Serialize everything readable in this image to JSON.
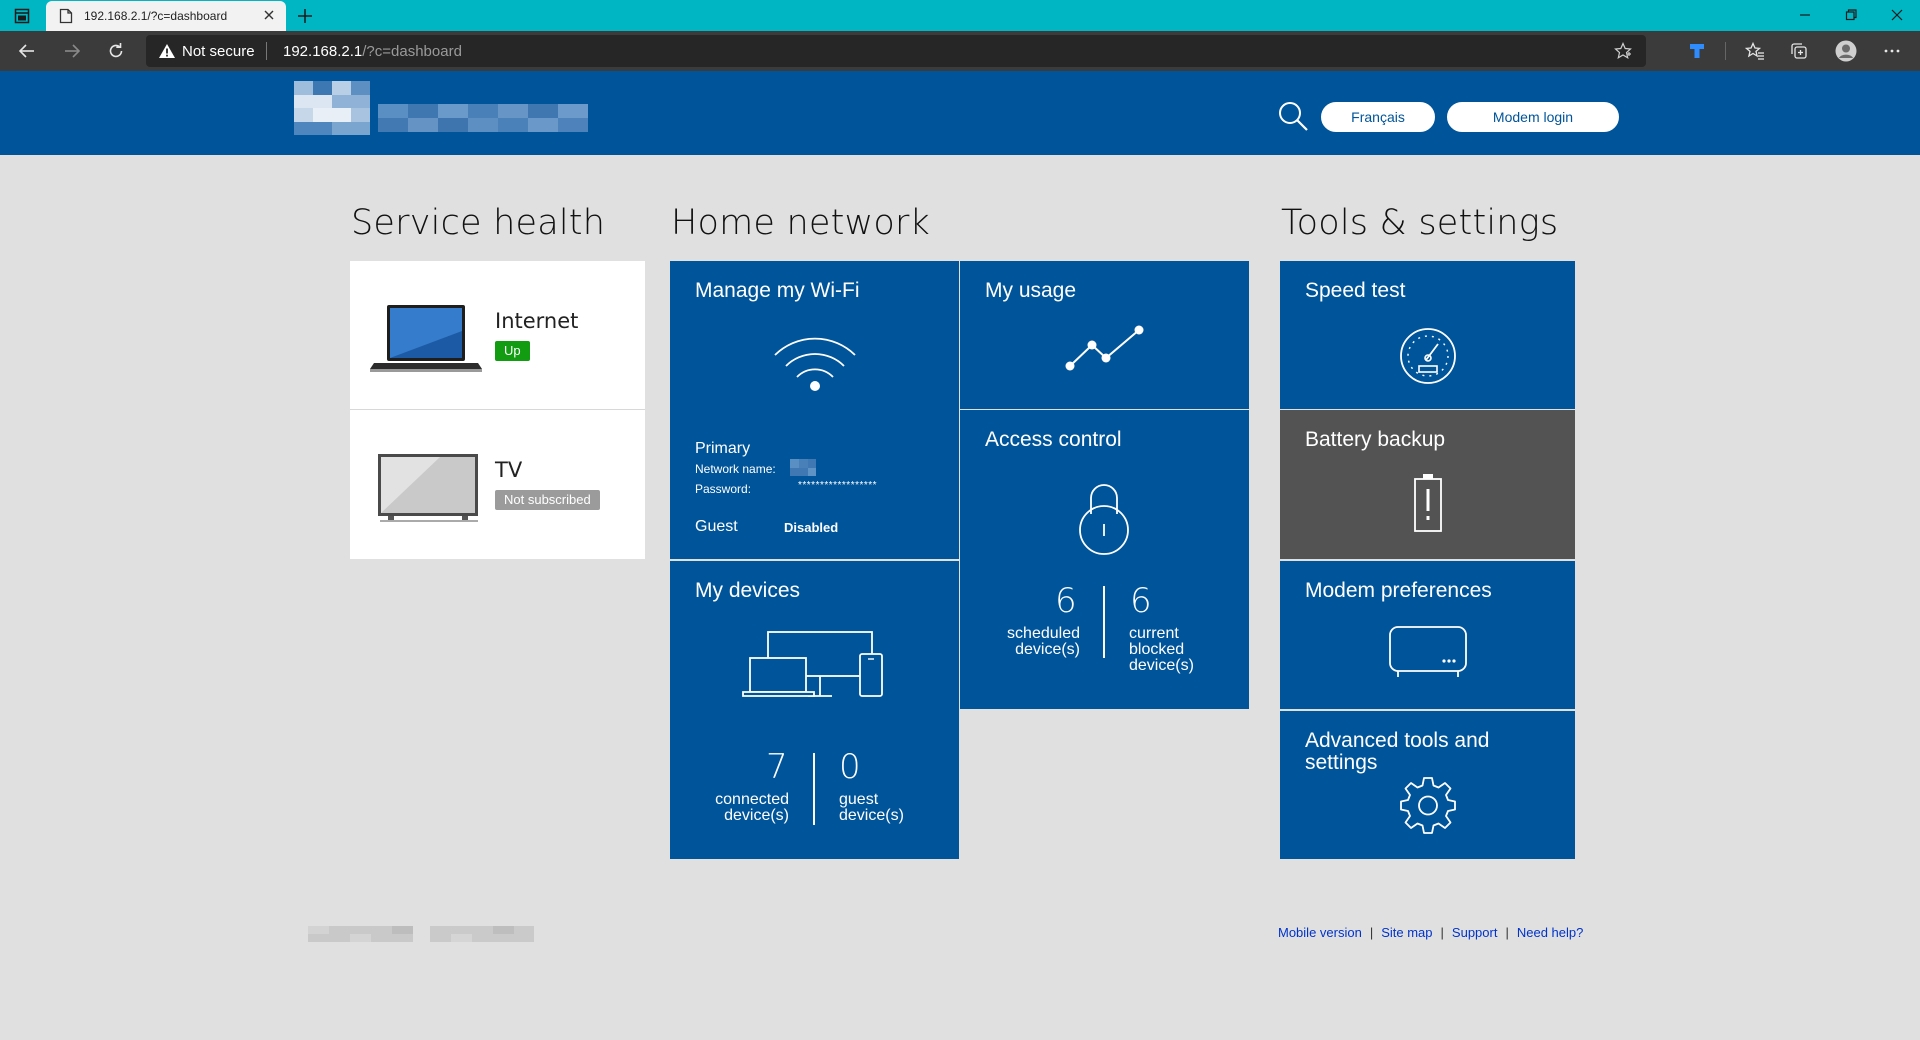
{
  "browser": {
    "tab_title": "192.168.2.1/?c=dashboard",
    "security_label": "Not secure",
    "url_host": "192.168.2.1",
    "url_path": "/?c=dashboard"
  },
  "header": {
    "language_button": "Français",
    "login_button": "Modem login"
  },
  "service_health": {
    "title": "Service health",
    "items": [
      {
        "label": "Internet",
        "status": "Up",
        "status_color": "#129c12"
      },
      {
        "label": "TV",
        "status": "Not subscribed",
        "status_color": "#9b9b9b"
      }
    ]
  },
  "home_network": {
    "title": "Home network",
    "wifi": {
      "title": "Manage my Wi-Fi",
      "primary_label": "Primary",
      "network_name_label": "Network name:",
      "password_label": "Password:",
      "password_value": "******************",
      "guest_label": "Guest",
      "guest_value": "Disabled"
    },
    "usage": {
      "title": "My usage"
    },
    "devices": {
      "title": "My devices",
      "connected_count": "7",
      "connected_label_1": "connected",
      "connected_label_2": "device(s)",
      "guest_count": "0",
      "guest_label_1": "guest",
      "guest_label_2": "device(s)"
    },
    "access_control": {
      "title": "Access control",
      "scheduled_count": "6",
      "scheduled_label_1": "scheduled",
      "scheduled_label_2": "device(s)",
      "blocked_count": "6",
      "blocked_label_1": "current",
      "blocked_label_2": "blocked",
      "blocked_label_3": "device(s)"
    }
  },
  "tools": {
    "title": "Tools & settings",
    "speed_test": "Speed test",
    "battery_backup": "Battery backup",
    "modem_preferences": "Modem preferences",
    "advanced_line_1": "Advanced tools and",
    "advanced_line_2": "settings"
  },
  "footer": {
    "mobile": "Mobile version",
    "sitemap": "Site map",
    "support": "Support",
    "help": "Need help?",
    "separator": "|"
  },
  "colors": {
    "brand_blue": "#00549a",
    "tab_bar": "#00b6c2",
    "battery_tile": "#535353",
    "page_bg": "#e0e0e0"
  }
}
